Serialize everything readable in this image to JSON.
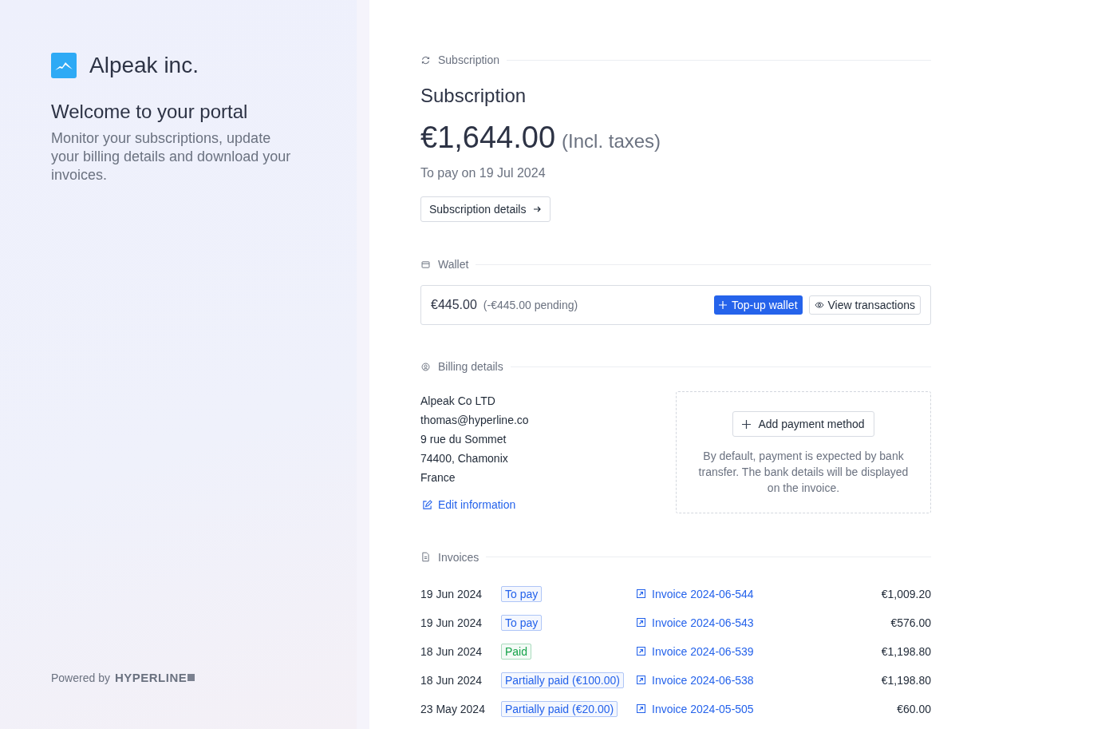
{
  "brand": {
    "name": "Alpeak inc."
  },
  "welcome": {
    "title": "Welcome to your portal",
    "text": "Monitor your subscriptions, update your billing details and download your invoices."
  },
  "footer": {
    "powered_by": "Powered by",
    "logo": "HYPERLINE"
  },
  "subscription": {
    "section": "Subscription",
    "title": "Subscription",
    "amount": "€1,644.00",
    "tax_note": "(Incl. taxes)",
    "due": "To pay on 19 Jul 2024",
    "details_button": "Subscription details"
  },
  "wallet": {
    "section": "Wallet",
    "balance": "€445.00",
    "pending": "(-€445.00 pending)",
    "topup_button": "Top-up wallet",
    "transactions_button": "View transactions"
  },
  "billing": {
    "section": "Billing details",
    "lines": [
      "Alpeak Co LTD",
      "thomas@hyperline.co",
      "9 rue du Sommet",
      "74400, Chamonix",
      "France"
    ],
    "edit_link": "Edit information",
    "add_payment_button": "Add payment method",
    "payment_note": "By default, payment is expected by bank transfer. The bank details will be displayed on the invoice."
  },
  "invoices": {
    "section": "Invoices",
    "rows": [
      {
        "date": "19 Jun 2024",
        "status": "To pay",
        "color": "#2563eb",
        "invoice": "Invoice 2024-06-544",
        "amount": "€1,009.20"
      },
      {
        "date": "19 Jun 2024",
        "status": "To pay",
        "color": "#2563eb",
        "invoice": "Invoice 2024-06-543",
        "amount": "€576.00"
      },
      {
        "date": "18 Jun 2024",
        "status": "Paid",
        "color": "#16a34a",
        "invoice": "Invoice 2024-06-539",
        "amount": "€1,198.80"
      },
      {
        "date": "18 Jun 2024",
        "status": "Partially paid (€100.00)",
        "color": "#2563eb",
        "invoice": "Invoice 2024-06-538",
        "amount": "€1,198.80"
      },
      {
        "date": "23 May 2024",
        "status": "Partially paid (€20.00)",
        "color": "#2563eb",
        "invoice": "Invoice 2024-05-505",
        "amount": "€60.00"
      }
    ]
  }
}
